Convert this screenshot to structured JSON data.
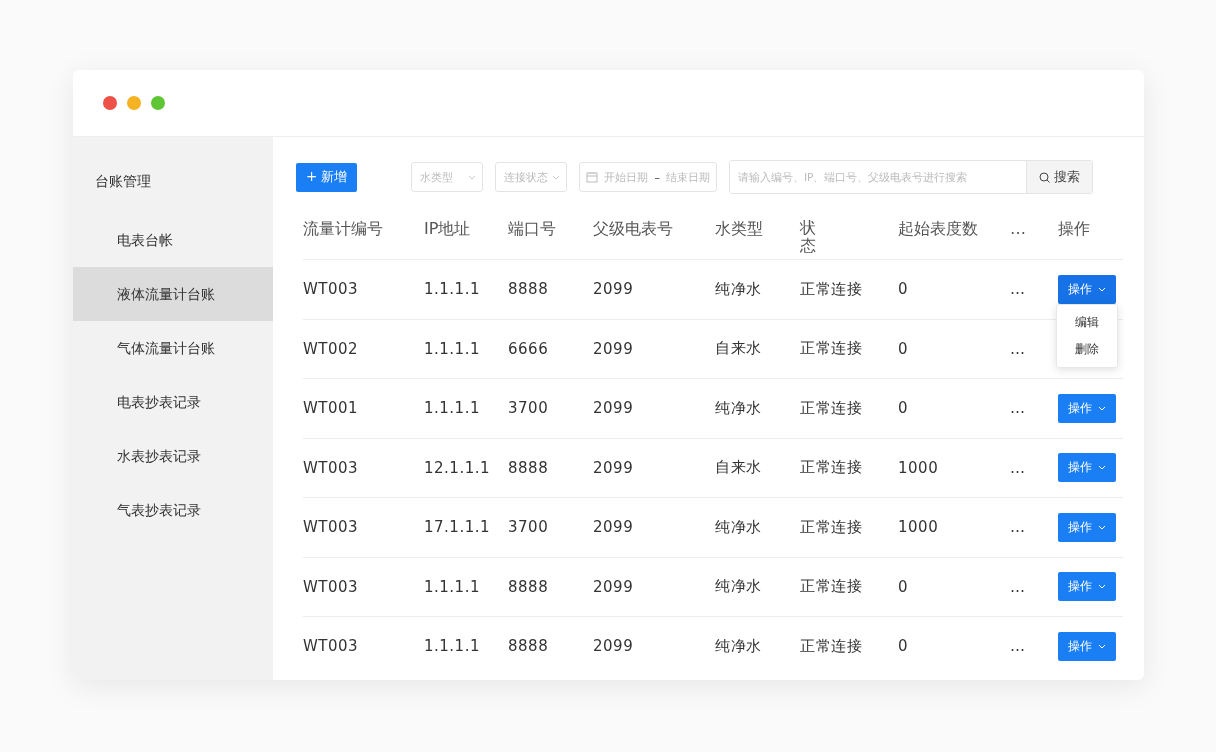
{
  "sidebar": {
    "title": "台账管理",
    "items": [
      {
        "label": "电表台帐",
        "selected": false
      },
      {
        "label": "液体流量计台账",
        "selected": true
      },
      {
        "label": "气体流量计台账",
        "selected": false
      },
      {
        "label": "电表抄表记录",
        "selected": false
      },
      {
        "label": "水表抄表记录",
        "selected": false
      },
      {
        "label": "气表抄表记录",
        "selected": false
      }
    ]
  },
  "toolbar": {
    "add_button": "+ 新增",
    "filters": [
      {
        "placeholder": "水类型"
      },
      {
        "placeholder": "连接状态"
      }
    ],
    "date_range": {
      "start_placeholder": "开始日期",
      "separator": "–",
      "end_placeholder": "结束日期"
    },
    "search": {
      "placeholder": "请输入编号、IP、端口号、父级电表号进行搜索",
      "button": "搜索"
    }
  },
  "table": {
    "columns": [
      "流量计编号",
      "IP地址",
      "端口号",
      "父级电表号",
      "水类型",
      "状态",
      "起始表度数",
      "…",
      "操作"
    ],
    "rows": [
      {
        "cells": [
          "WT003",
          "1.1.1.1",
          "8888",
          "2099",
          "纯净水",
          "正常连接",
          "0",
          "…"
        ],
        "action": "操作",
        "menu_open": true,
        "menu": [
          "编辑",
          "删除"
        ]
      },
      {
        "cells": [
          "WT002",
          "1.1.1.1",
          "6666",
          "2099",
          "自来水",
          "正常连接",
          "0",
          "…"
        ]
      },
      {
        "cells": [
          "WT001",
          "1.1.1.1",
          "3700",
          "2099",
          "纯净水",
          "正常连接",
          "0",
          "…"
        ],
        "action": "操作"
      },
      {
        "cells": [
          "WT003",
          "12.1.1.1",
          "8888",
          "2099",
          "自来水",
          "正常连接",
          "1000",
          "…"
        ],
        "action": "操作"
      },
      {
        "cells": [
          "WT003",
          "17.1.1.1",
          "3700",
          "2099",
          "纯净水",
          "正常连接",
          "1000",
          "…"
        ],
        "action": "操作"
      },
      {
        "cells": [
          "WT003",
          "1.1.1.1",
          "8888",
          "2099",
          "纯净水",
          "正常连接",
          "0",
          "…"
        ],
        "action": "操作"
      },
      {
        "cells": [
          "WT003",
          "1.1.1.1",
          "8888",
          "2099",
          "纯净水",
          "正常连接",
          "0",
          "…"
        ],
        "action": "操作"
      }
    ]
  }
}
